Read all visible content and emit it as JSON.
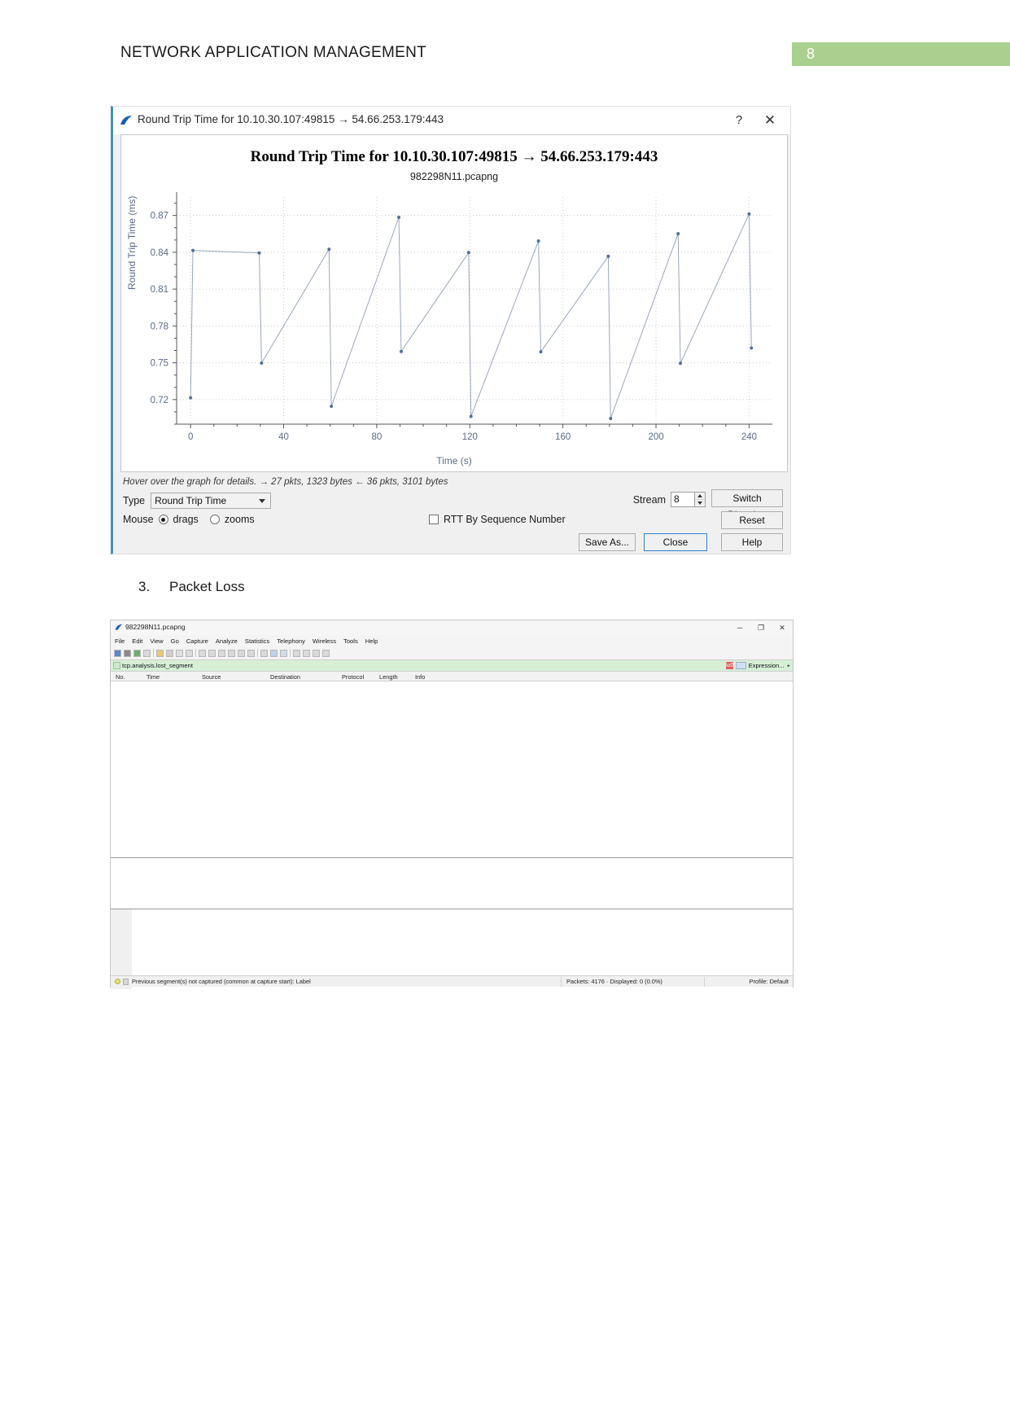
{
  "document": {
    "header_title": "NETWORK APPLICATION MANAGEMENT",
    "page_number": "8",
    "accent_green": "#a9d08e",
    "section": {
      "number": "3.",
      "title": "Packet Loss"
    }
  },
  "rtt_dialog": {
    "window_title": "Round Trip Time for 10.10.30.107:49815 → 54.66.253.179:443",
    "help_glyph": "?",
    "close_glyph": "✕",
    "hint_text": "Hover over the graph for details. → 27 pkts, 1323 bytes ← 36 pkts, 3101 bytes",
    "type_label": "Type",
    "type_value": "Round Trip Time",
    "mouse_label": "Mouse",
    "mouse_drags": "drags",
    "mouse_zooms": "zooms",
    "mouse_selected": "drags",
    "rtt_by_seq_label": "RTT By Sequence Number",
    "rtt_by_seq_checked": false,
    "stream_label": "Stream",
    "stream_value": "8",
    "buttons": {
      "switch_direction": "Switch Direction",
      "reset": "Reset",
      "save_as": "Save As...",
      "close": "Close",
      "help": "Help"
    }
  },
  "chart_data": {
    "type": "scatter",
    "title": "Round Trip Time for 10.10.30.107:49815 → 54.66.253.179:443",
    "subtitle": "982298N11.pcapng",
    "xlabel": "Time (s)",
    "ylabel": "Round Trip Time (ms)",
    "xlim": [
      -6,
      250
    ],
    "ylim": [
      0.7,
      0.885
    ],
    "xticks": [
      0,
      40,
      80,
      120,
      160,
      200,
      240
    ],
    "yticks": [
      0.72,
      0.75,
      0.78,
      0.81,
      0.84,
      0.87
    ],
    "ytick_labels": [
      "0.72",
      "0.75",
      "0.78",
      "0.81",
      "0.84",
      "0.87"
    ],
    "grid": true,
    "legend": "none",
    "point_color": "#3b5b8c",
    "line_color": "#9aa6bb",
    "points": [
      {
        "x": 0,
        "y": 0.7215
      },
      {
        "x": 1,
        "y": 0.8415
      },
      {
        "x": 29.5,
        "y": 0.8395
      },
      {
        "x": 30.5,
        "y": 0.7497
      },
      {
        "x": 59.5,
        "y": 0.8425
      },
      {
        "x": 60.5,
        "y": 0.7145
      },
      {
        "x": 89.5,
        "y": 0.8685
      },
      {
        "x": 90.5,
        "y": 0.7592
      },
      {
        "x": 119.5,
        "y": 0.8398
      },
      {
        "x": 120.5,
        "y": 0.7063
      },
      {
        "x": 149.5,
        "y": 0.8492
      },
      {
        "x": 150.5,
        "y": 0.7589
      },
      {
        "x": 179.5,
        "y": 0.8368
      },
      {
        "x": 180.5,
        "y": 0.7046
      },
      {
        "x": 209.5,
        "y": 0.8552
      },
      {
        "x": 210.5,
        "y": 0.7496
      },
      {
        "x": 240,
        "y": 0.8712
      },
      {
        "x": 241,
        "y": 0.762
      }
    ]
  },
  "wireshark": {
    "title": "982298N11.pcapng",
    "minimize_glyph": "─",
    "maximize_glyph": "❐",
    "close_glyph": "✕",
    "menu": [
      "File",
      "Edit",
      "View",
      "Go",
      "Capture",
      "Analyze",
      "Statistics",
      "Telephony",
      "Wireless",
      "Tools",
      "Help"
    ],
    "filter_value": "tcp.analysis.lost_segment",
    "filter_expression_label": "Expression...",
    "filter_plus_label": "+",
    "columns": [
      "No.",
      "Time",
      "Source",
      "Destination",
      "Protocol",
      "Length",
      "Info"
    ],
    "status_left": "Previous segment(s) not captured (common at capture start): Label",
    "status_center": "Packets: 4176 · Displayed: 0 (0.0%)",
    "status_right": "Profile: Default"
  }
}
